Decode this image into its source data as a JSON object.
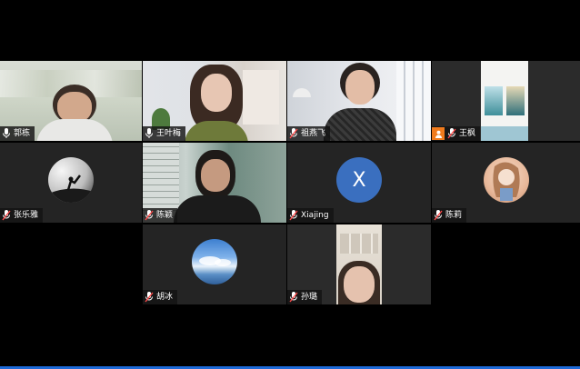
{
  "participants": [
    {
      "name": "郭栋",
      "type": "video"
    },
    {
      "name": "王叶梅",
      "type": "video"
    },
    {
      "name": "祖燕飞",
      "type": "video"
    },
    {
      "name": "王枫",
      "type": "video"
    },
    {
      "name": "张乐雅",
      "type": "avatar"
    },
    {
      "name": "陈颖",
      "type": "video"
    },
    {
      "name": "Xiajing",
      "type": "initial",
      "initial": "X"
    },
    {
      "name": "陈莉",
      "type": "avatar"
    },
    {
      "name": "胡冰",
      "type": "avatar"
    },
    {
      "name": "孙璐",
      "type": "video"
    }
  ],
  "colors": {
    "tile_bg": "#242424",
    "initial_circle": "#3a6fbf",
    "host_badge": "#f07b1d",
    "muted_mic": "#ff4a4a"
  }
}
